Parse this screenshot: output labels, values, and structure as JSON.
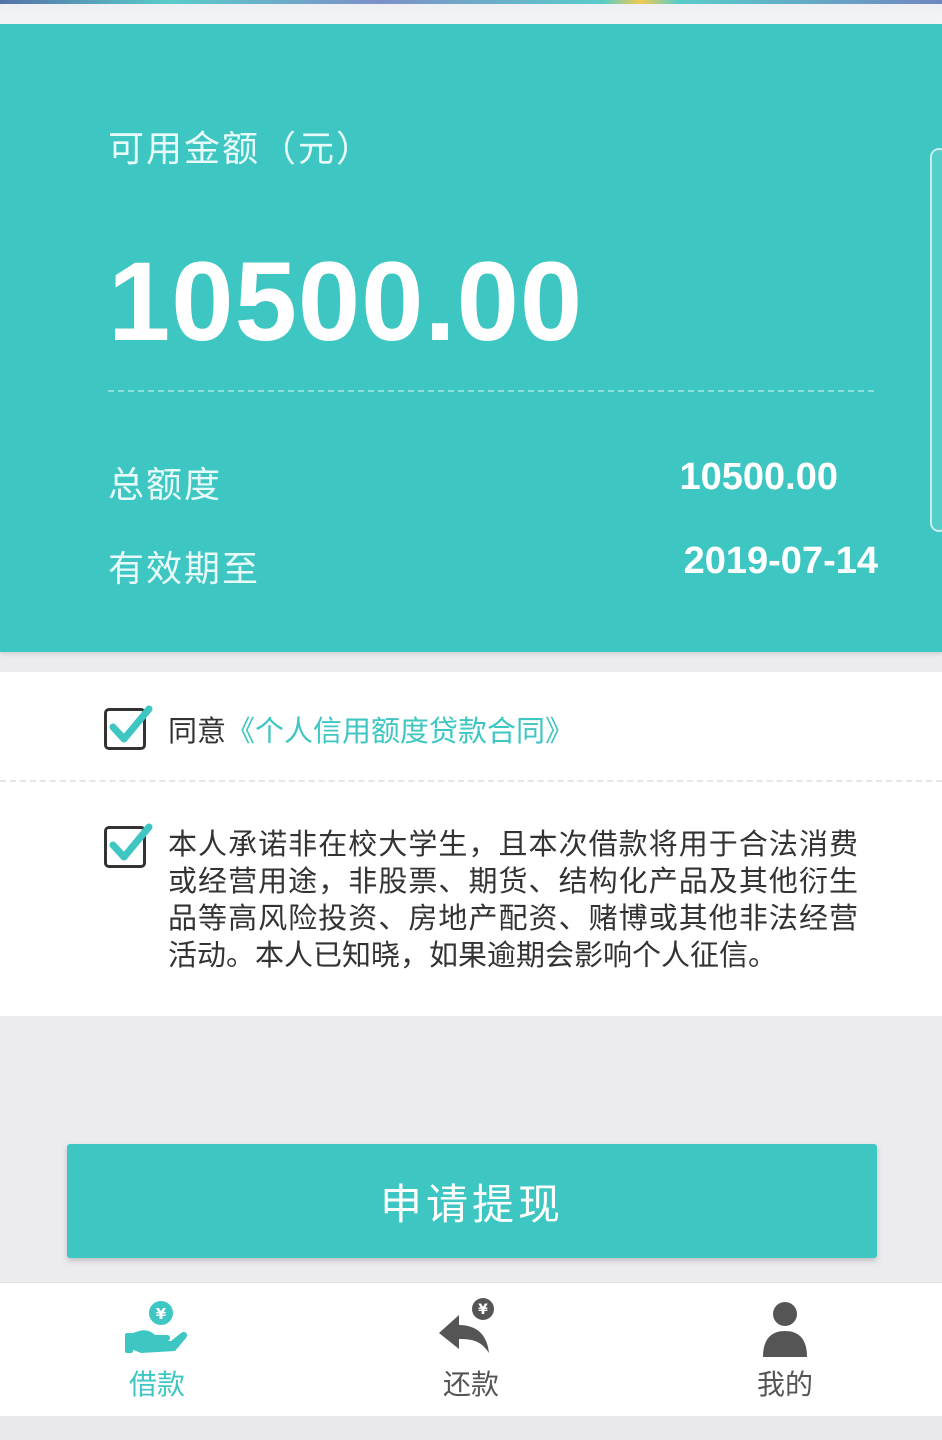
{
  "card": {
    "available_label": "可用金额（元）",
    "available_amount": "10500.00",
    "total_label": "总额度",
    "total_value": "10500.00",
    "valid_label": "有效期至",
    "valid_value": "2019-07-14"
  },
  "terms": {
    "agree_prefix": "同意",
    "contract_link": "《个人信用额度贷款合同》",
    "promise_text": "本人承诺非在校大学生，且本次借款将用于合法消费或经营用途，非股票、期货、结构化产品及其他衍生品等高风险投资、房地产配资、赌博或其他非法经营活动。本人已知晓，如果逾期会影响个人征信。",
    "agree_checked": true,
    "promise_checked": true
  },
  "apply_button": "申请提现",
  "tabs": [
    {
      "label": "借款",
      "icon": "loan-hand-yuan-icon",
      "active": true
    },
    {
      "label": "还款",
      "icon": "repay-arrow-yuan-icon",
      "active": false
    },
    {
      "label": "我的",
      "icon": "user-profile-icon",
      "active": false
    }
  ],
  "colors": {
    "accent": "#3ec6c2",
    "text": "#333333",
    "background": "#ececf0"
  }
}
